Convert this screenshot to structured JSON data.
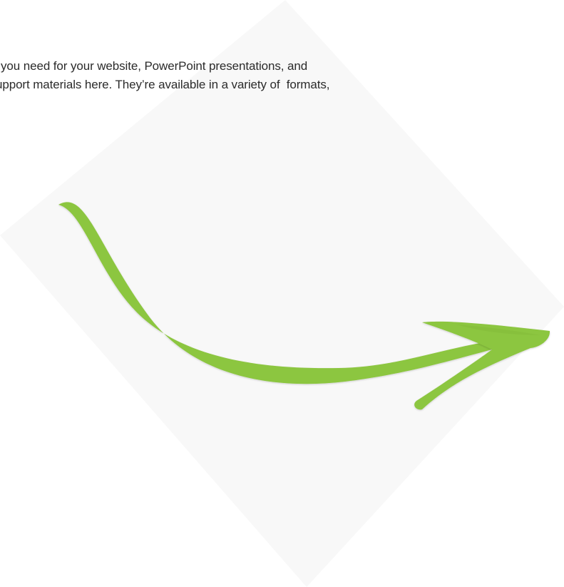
{
  "text": {
    "line1": "s you need for your website, PowerPoint presentations, and",
    "line2": "upport materials here. They’re available in a variety of  formats,"
  },
  "colors": {
    "background": "#ffffff",
    "panel": "#f8f8f8",
    "arrow": "#8cc63f",
    "arrow_dark": "#7db536",
    "text": "#2b2b2b"
  },
  "icons": {
    "arrow": "curved-arrow-icon"
  }
}
